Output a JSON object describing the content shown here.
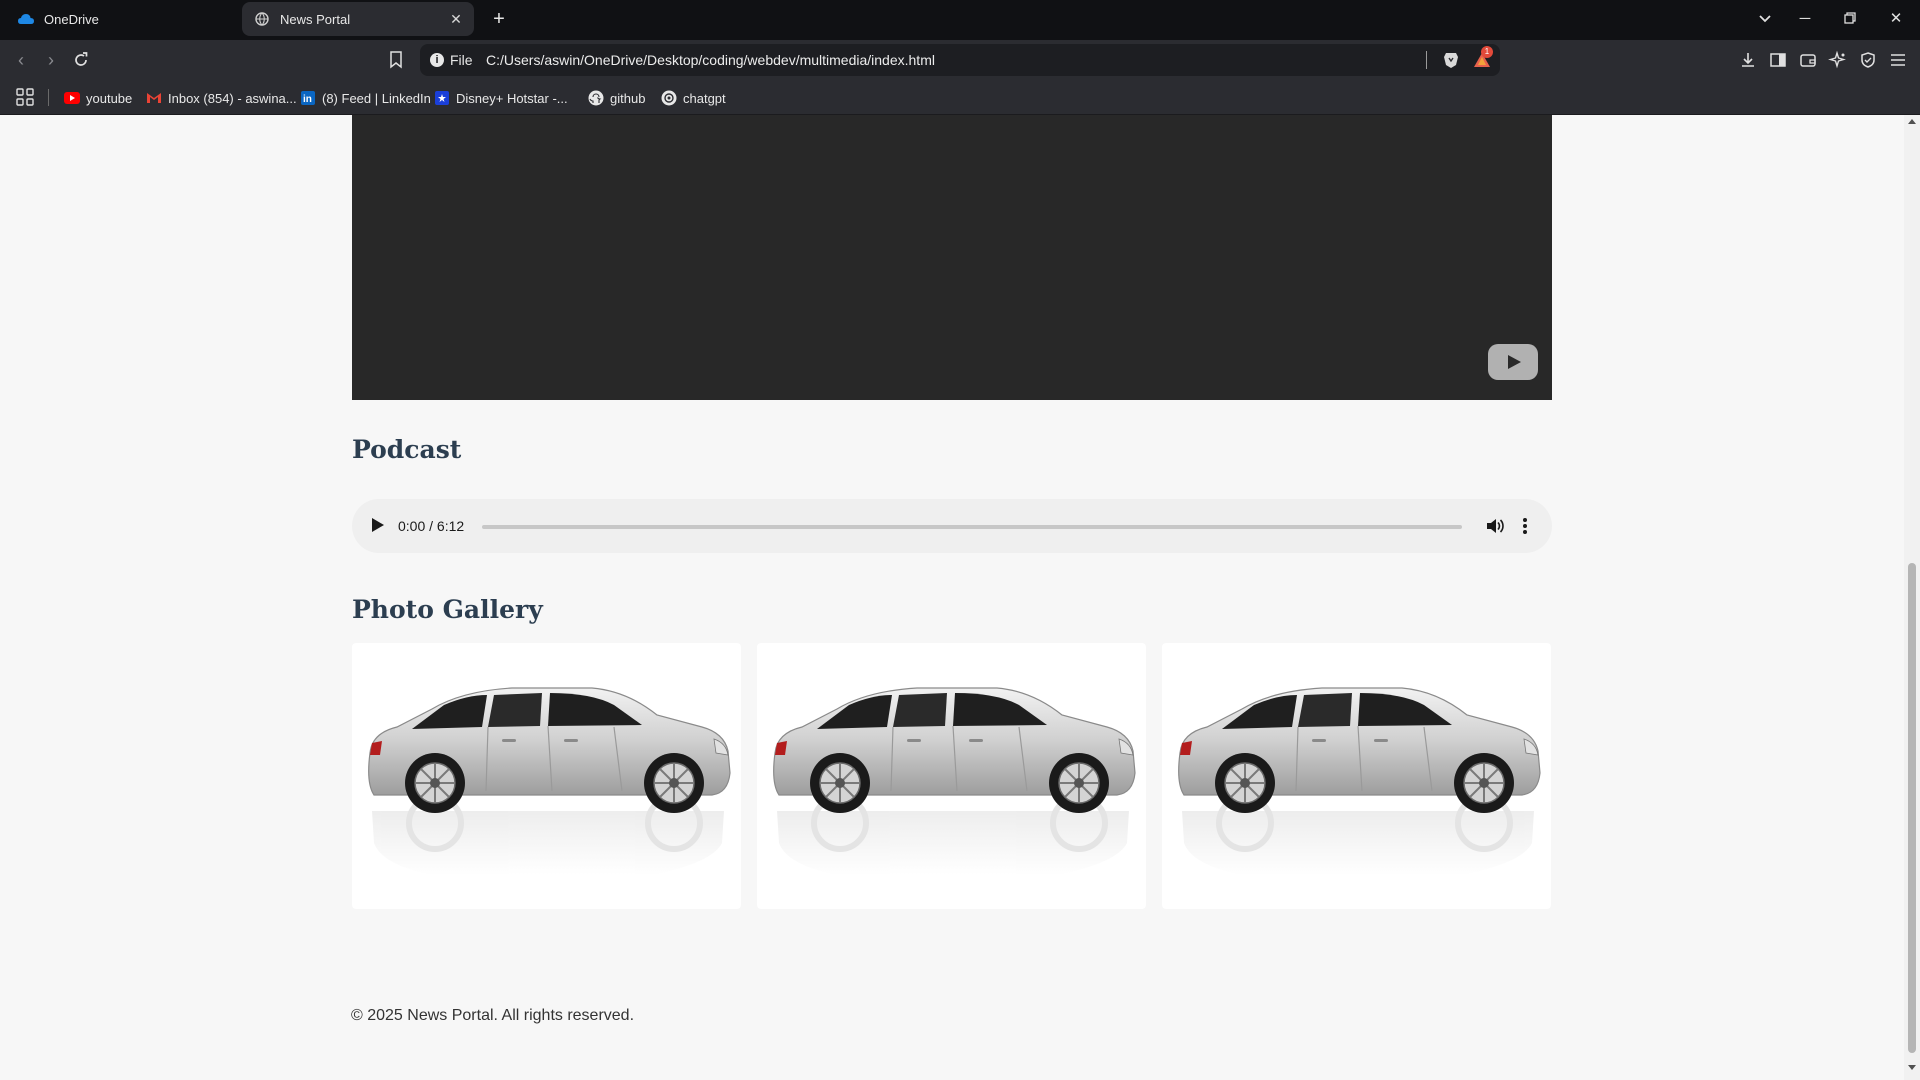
{
  "browser": {
    "tabs": [
      {
        "title": "OneDrive",
        "icon": "onedrive-cloud-icon",
        "active": false
      },
      {
        "title": "News Portal",
        "icon": "globe-icon",
        "active": true
      }
    ],
    "url_scheme_label": "File",
    "url": "C:/Users/aswin/OneDrive/Desktop/coding/webdev/multimedia/index.html",
    "rewards_badge": "1",
    "bookmarks": [
      {
        "label": "youtube",
        "icon": "youtube-icon"
      },
      {
        "label": "Inbox (854) - aswina...",
        "icon": "gmail-icon"
      },
      {
        "label": "(8) Feed | LinkedIn",
        "icon": "linkedin-icon"
      },
      {
        "label": "Disney+ Hotstar -...",
        "icon": "hotstar-icon"
      },
      {
        "label": "github",
        "icon": "github-icon"
      },
      {
        "label": "chatgpt",
        "icon": "chatgpt-icon"
      }
    ]
  },
  "page": {
    "podcast": {
      "title": "Podcast",
      "time": "0:00 / 6:12"
    },
    "gallery": {
      "title": "Photo Gallery",
      "photos": [
        {
          "alt": "silver car"
        },
        {
          "alt": "silver car"
        },
        {
          "alt": "silver car"
        }
      ]
    },
    "footer": "© 2025 News Portal. All rights reserved."
  },
  "colors": {
    "heading": "#2c3e50",
    "video_bg": "#282828",
    "page_bg": "#f7f7f7"
  }
}
